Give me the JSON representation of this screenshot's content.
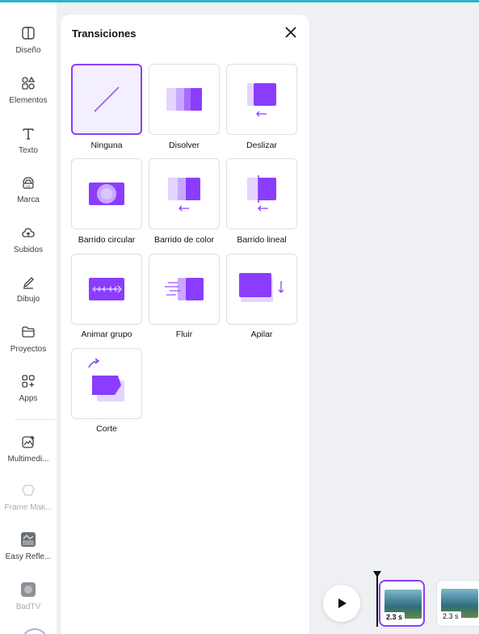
{
  "sidebar": {
    "items": [
      {
        "label": "Diseño",
        "icon": "layout-icon"
      },
      {
        "label": "Elementos",
        "icon": "shapes-icon"
      },
      {
        "label": "Texto",
        "icon": "text-icon"
      },
      {
        "label": "Marca",
        "icon": "brand-icon"
      },
      {
        "label": "Subidos",
        "icon": "upload-cloud-icon"
      },
      {
        "label": "Dibujo",
        "icon": "pen-icon"
      },
      {
        "label": "Proyectos",
        "icon": "folder-icon"
      },
      {
        "label": "Apps",
        "icon": "apps-grid-icon"
      },
      {
        "label": "Multimedi...",
        "icon": "magic-media-icon"
      },
      {
        "label": "Frame Mak...",
        "icon": "frame-maker-icon"
      },
      {
        "label": "Easy Refle...",
        "icon": "easy-reflections-icon"
      },
      {
        "label": "BadTV",
        "icon": "badtv-icon"
      }
    ]
  },
  "panel": {
    "title": "Transiciones",
    "close_icon": "close-icon",
    "transitions": [
      {
        "label": "Ninguna",
        "selected": true
      },
      {
        "label": "Disolver",
        "selected": false
      },
      {
        "label": "Deslizar",
        "selected": false
      },
      {
        "label": "Barrido circular",
        "selected": false
      },
      {
        "label": "Barrido de color",
        "selected": false
      },
      {
        "label": "Barrido lineal",
        "selected": false
      },
      {
        "label": "Animar grupo",
        "selected": false
      },
      {
        "label": "Fluir",
        "selected": false
      },
      {
        "label": "Apilar",
        "selected": false
      },
      {
        "label": "Corte",
        "selected": false
      }
    ]
  },
  "timeline": {
    "play_icon": "play-icon",
    "clips": [
      {
        "duration": "2.3 s",
        "selected": true
      },
      {
        "duration": "2.3 s",
        "selected": false
      }
    ]
  },
  "colors": {
    "accent": "#8b3dff",
    "accent_light": "#c9a8ff",
    "top_line": "#2bb3c9"
  }
}
